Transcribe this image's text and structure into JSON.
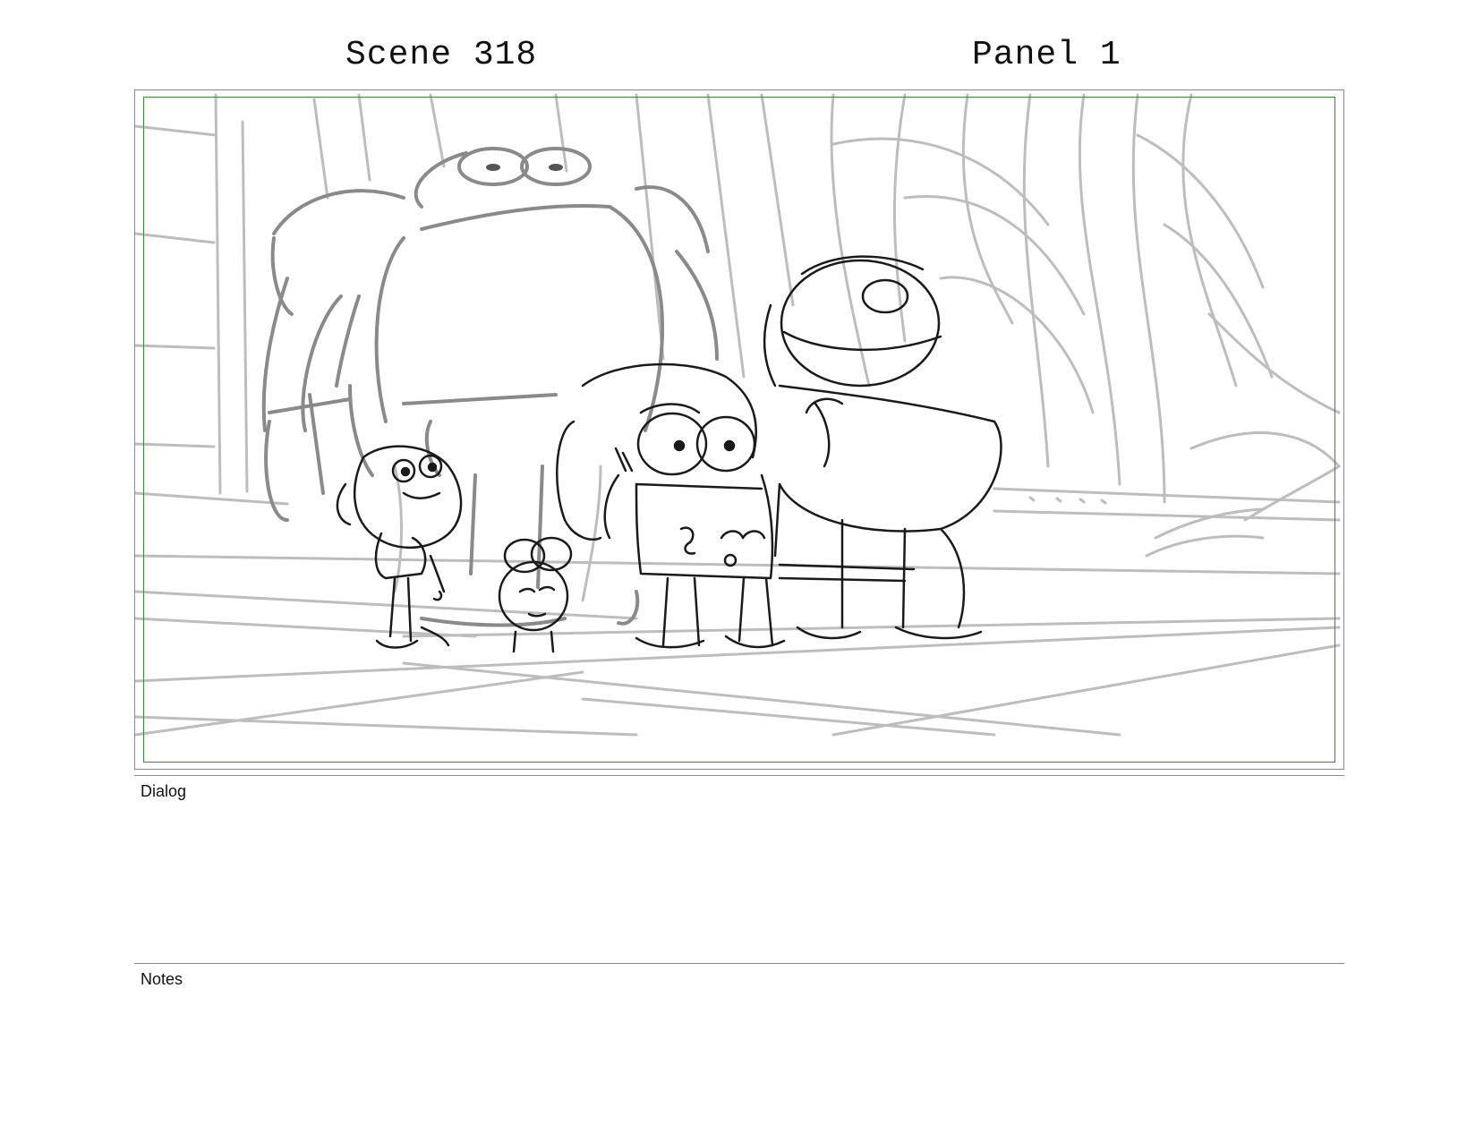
{
  "header": {
    "scene": "Scene 318",
    "panel": "Panel 1"
  },
  "dialog": {
    "label": "Dialog",
    "text": ""
  },
  "notes": {
    "label": "Notes",
    "text": ""
  },
  "colors": {
    "safe_frame": "#3a8a3a",
    "sketch_dark": "#1a1a1a",
    "sketch_light": "#b8b8b8",
    "sketch_mid": "#7a7a7a"
  }
}
